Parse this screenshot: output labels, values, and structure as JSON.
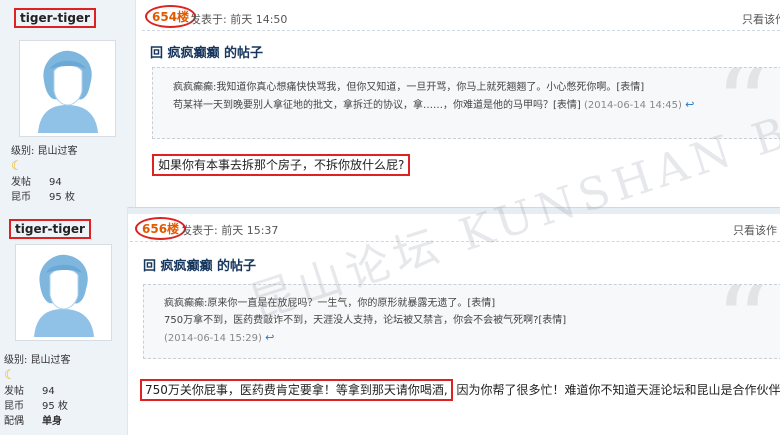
{
  "post1": {
    "username": "tiger-tiger",
    "floor": "654楼",
    "posted_label": "发表于: 前天 14:50",
    "only_view": "只看该作",
    "title": "回 疯疯癫癫 的帖子",
    "quote_line1": "疯疯癫癫:我知道你真心想痛快快骂我，但你又知道，一旦开骂，你马上就死翘翘了。小心憋死你啊。[表情]",
    "quote_line2": "苟某祥一天到晚要别人拿征地的批文，拿拆迁的协议，拿……，你难道是他的马甲吗？[表情]",
    "quote_time": "(2014-06-14 14:45)",
    "reply": "如果你有本事去拆那个房子，不拆你放什么屁?",
    "level_label": "级别: 昆山过客",
    "posts_key": "发帖",
    "posts_val": "94",
    "coins_key": "昆币",
    "coins_val": "95 枚"
  },
  "post2": {
    "username": "tiger-tiger",
    "floor": "656楼",
    "posted_label": "发表于: 前天  15:37",
    "only_view": "只看该作",
    "title": "回 疯疯癫癫 的帖子",
    "quote_line1": "疯疯癫癫:原来你一直是在放屁吗？一生气，你的原形就暴露无遗了。[表情]",
    "quote_line2": "750万拿不到，医药费敲诈不到，天涯没人支持，论坛被又禁言，你会不会被气死啊?[表情]",
    "quote_time": "(2014-06-14 15:29)",
    "reply_boxed": "750万关你屁事，医药费肯定要拿！等拿到那天请你喝酒,",
    "reply_rest": " 因为你帮了很多忙！难道你不知道天涯论坛和昆山是合作伙伴吗",
    "level_label": "级别: 昆山过客",
    "posts_key": "发帖",
    "posts_val": "94",
    "coins_key": "昆币",
    "coins_val": "95 枚",
    "status_key": "配偶",
    "status_val": "单身"
  },
  "watermark": "昆山论坛 KUNSHAN BBS",
  "colors": {
    "floor": "#e05a00",
    "highlight_border": "#dd2222",
    "title": "#17365d"
  },
  "icons": [
    "user-avatar",
    "moon-icon",
    "reply-icon",
    "quote-mark-icon"
  ]
}
